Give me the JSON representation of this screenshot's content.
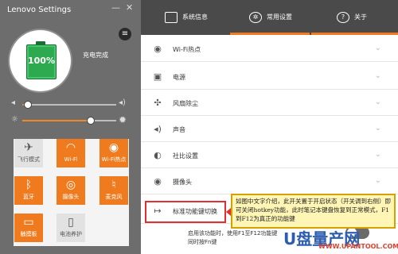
{
  "app": {
    "title": "Lenovo Settings"
  },
  "window": {
    "minimize_icon": "minimize-icon",
    "close_icon": "close-icon"
  },
  "battery": {
    "percent_text": "100%",
    "status_text": "充电完成",
    "level": 1.0
  },
  "volume_slider": {
    "value": 0.05,
    "left_icon": "speaker-low-icon",
    "right_icon": "speaker-high-icon"
  },
  "brightness_slider": {
    "value": 0.72,
    "left_icon": "brightness-low-icon",
    "right_icon": "brightness-high-icon"
  },
  "quick_tiles": [
    {
      "label": "飞行模式",
      "state": "off",
      "icon": "airplane-icon"
    },
    {
      "label": "Wi-Fi",
      "state": "on",
      "icon": "wifi-icon"
    },
    {
      "label": "Wi-Fi热点",
      "state": "on",
      "icon": "hotspot-icon"
    },
    {
      "label": "蓝牙",
      "state": "on",
      "icon": "bluetooth-icon"
    },
    {
      "label": "摄像头",
      "state": "on",
      "icon": "camera-icon"
    },
    {
      "label": "麦克风",
      "state": "on",
      "icon": "microphone-icon"
    },
    {
      "label": "触摸板",
      "state": "on",
      "icon": "touchpad-icon"
    },
    {
      "label": "电池养护",
      "state": "off",
      "icon": "battery-care-icon"
    }
  ],
  "tabs": [
    {
      "label": "系统信息",
      "icon": "monitor-icon"
    },
    {
      "label": "常用设置",
      "icon": "gear-icon",
      "active": true
    },
    {
      "label": "关于",
      "icon": "question-icon"
    }
  ],
  "settings_rows": [
    {
      "label": "Wi-Fi热点",
      "icon": "hotspot-icon"
    },
    {
      "label": "电源",
      "icon": "power-plug-icon"
    },
    {
      "label": "风扇除尘",
      "icon": "fan-icon"
    },
    {
      "label": "声音",
      "icon": "speaker-icon"
    },
    {
      "label": "社比设置",
      "icon": "half-circle-icon"
    },
    {
      "label": "摄像头",
      "icon": "camera-icon"
    },
    {
      "label": "标准功能键切换",
      "icon": "key-arrow-icon"
    }
  ],
  "fn_switch": {
    "description_line1": "启用该功能时，使用F1至F12功能键",
    "description_line2": "同时按Fn键",
    "state": "off"
  },
  "annotation": {
    "text": "如图中文字介绍，此开关置于开启状态（开关调到右侧）即可关闭hotkey功能，此时笔记本键盘恢复到正常模式，F1到F12为真正的功能键"
  },
  "watermark": {
    "brand": "U盘量产网",
    "url": "WWW.UPANTOOL.COM"
  },
  "colors": {
    "accent": "#ef7b1e",
    "panel": "#6d6d6d",
    "tabbar": "#4a4a4a",
    "callout_bg": "#fff5b5",
    "highlight": "#e03030"
  }
}
